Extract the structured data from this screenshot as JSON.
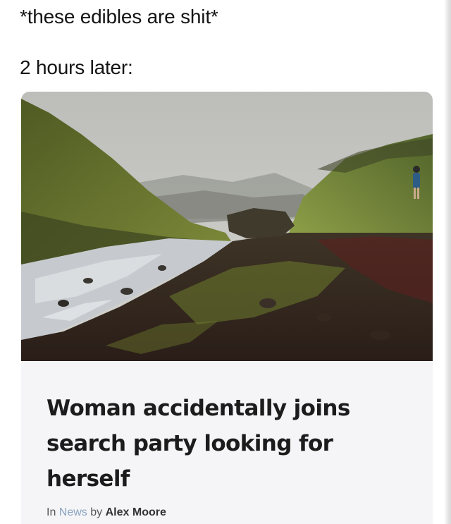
{
  "meme": {
    "line1": "*these edibles are shit*",
    "line2": "2 hours later:"
  },
  "article": {
    "headline": "Woman accidentally joins search party looking for herself",
    "byline_in": "In",
    "byline_category": "News",
    "byline_by": "by",
    "byline_author": "Alex Moore"
  },
  "colors": {
    "sky": "#c9c9c6",
    "grass": "#6b7a2a",
    "river": "#c8ccd0",
    "earth": "#4a2a22",
    "card_bg": "#f5f5f7",
    "category_link": "#8aa3c2"
  }
}
